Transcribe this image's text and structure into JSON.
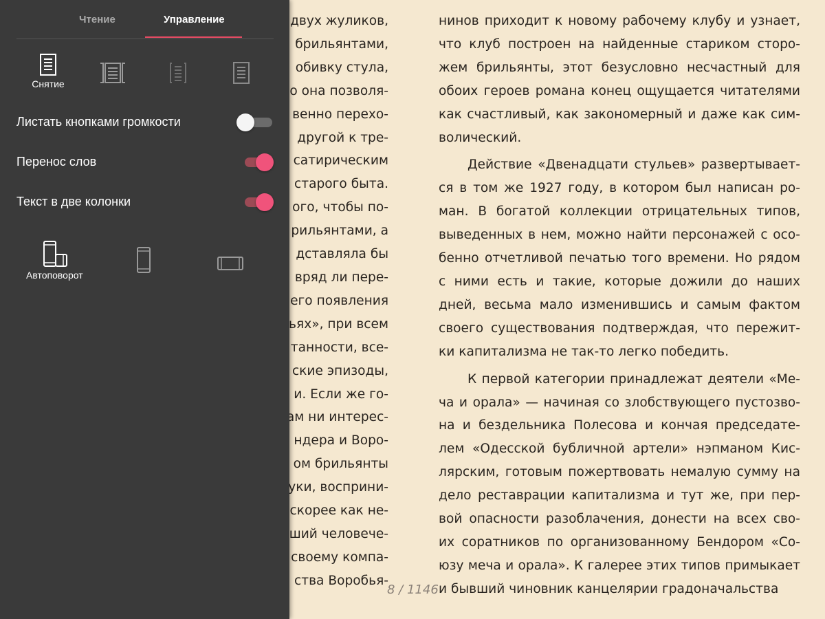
{
  "settings": {
    "tabs": [
      "Чтение",
      "Управление"
    ],
    "active_tab": "Управление",
    "accent_color": "#e74b64",
    "display_modes": [
      {
        "icon": "page-single-icon",
        "label": "Снятие",
        "selected": true
      },
      {
        "icon": "page-curl-both-icon",
        "label": "",
        "selected": false
      },
      {
        "icon": "page-curl-icon",
        "label": "",
        "selected": false
      },
      {
        "icon": "page-plain-icon",
        "label": "",
        "selected": false
      }
    ],
    "options": [
      {
        "label": "Листать кнопками громкости",
        "enabled": false
      },
      {
        "label": "Перенос слов",
        "enabled": true
      },
      {
        "label": "Текст в две колонки",
        "enabled": true
      }
    ],
    "rotation_modes": [
      {
        "icon": "auto-rotate-icon",
        "label": "Автоповорот",
        "selected": true
      },
      {
        "icon": "portrait-phone-icon",
        "label": "",
        "selected": false
      },
      {
        "icon": "landscape-phone-icon",
        "label": "",
        "selected": false
      }
    ]
  },
  "reader": {
    "left_column": [
      "двух жуликов,",
      "брильянтами,",
      "обивку стула,",
      "о она позволя-",
      "венно перехо-",
      "другой к тре-",
      "сатирическим",
      "старого быта.",
      "ого, чтобы по-",
      "рильянтами, а",
      "дставляла бы",
      "вряд ли пере-",
      "его появления",
      "ьях», при всем",
      "танности, все-",
      "ские эпизоды,",
      "и. Если же го-",
      "ам ни интерес-",
      "ндера и Воро-",
      "ом брильянты",
      "уки, восприни-",
      "скорее как не-",
      "ший человече-",
      "своему компа-",
      "ства Воробья-"
    ],
    "right_paragraphs": [
      {
        "indent": false,
        "lines": [
          "нинов приходит к новому рабочему клубу и узнает,",
          "что клуб построен на найденные стариком сторо-",
          "жем брильянты, этот безусловно несчастный для",
          "обоих героев романа конец ощущается читателями",
          "как счастливый, как закономерный и даже как сим-",
          "волический."
        ]
      },
      {
        "indent": true,
        "lines": [
          "Действие «Двенадцати стульев» развертывает-",
          "ся в том же 1927 году, в котором был написан ро-",
          "ман. В богатой коллекции отрицательных типов,",
          "выведенных в нем, можно найти персонажей с осо-",
          "бенно отчетливой печатью того времени. Но рядом",
          "с ними есть и такие, которые дожили до наших",
          "дней, весьма мало изменившись и самым фактом",
          "своего существования подтверждая, что пережит-",
          "ки капитализма не так-то легко победить."
        ]
      },
      {
        "indent": true,
        "lines": [
          "К первой категории принадлежат деятели «Ме-",
          "ча и орала» — начиная со злобствующего пустозво-",
          "на и бездельника Полесова и кончая председате-",
          "лем «Одесской бубличной артели» нэпманом Кис-",
          "лярским, готовым пожертвовать немалую сумму на",
          "дело реставрации капитализма и тут же, при пер-",
          "вой опасности разоблачения, донести на всех сво-",
          "их соратников по организованному Бендором «Со-",
          "юзу меча и орала». К галерее этих типов примыкает",
          "и бывший чиновник канцелярии градоначальства"
        ]
      }
    ],
    "page_indicator": "8 / 1146"
  }
}
